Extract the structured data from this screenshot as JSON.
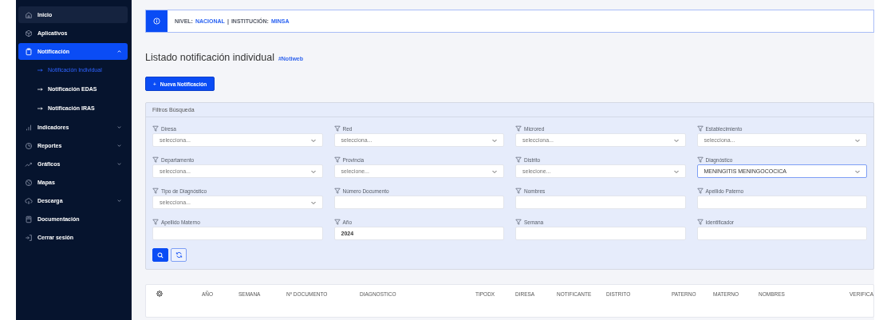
{
  "sidebar": {
    "items": [
      {
        "label": "Inicio",
        "kind": "item",
        "selected": false,
        "highlighted": true
      },
      {
        "label": "Aplicativos",
        "kind": "item",
        "selected": false,
        "highlighted": false
      },
      {
        "label": "Notificación",
        "kind": "item",
        "selected": true,
        "highlighted": false,
        "expanded": true,
        "children": [
          {
            "label": "Notificación Individual",
            "selected": true
          },
          {
            "label": "Notificación EDAS",
            "selected": false
          },
          {
            "label": "Notificación IRAS",
            "selected": false
          }
        ]
      },
      {
        "label": "Indicadores",
        "kind": "item",
        "selected": false,
        "highlighted": false,
        "expanded": false
      },
      {
        "label": "Reportes",
        "kind": "item",
        "selected": false,
        "highlighted": false,
        "expanded": false
      },
      {
        "label": "Gráficos",
        "kind": "item",
        "selected": false,
        "highlighted": false,
        "expanded": false
      },
      {
        "label": "Mapas",
        "kind": "item",
        "selected": false,
        "highlighted": false
      },
      {
        "label": "Descarga",
        "kind": "item",
        "selected": false,
        "highlighted": false,
        "expanded": false
      },
      {
        "label": "Documentación",
        "kind": "item",
        "selected": false,
        "highlighted": false
      },
      {
        "label": "Cerrar sesión",
        "kind": "item",
        "selected": false,
        "highlighted": false
      }
    ]
  },
  "info_bar": {
    "separator": "|",
    "items": [
      {
        "label": "NIVEL:",
        "value": "NACIONAL"
      },
      {
        "label": "INSTITUCIÓN:",
        "value": "MINSA"
      }
    ]
  },
  "page": {
    "title": "Listado notificación individual",
    "tag": "#Notiweb",
    "new_button": "Nueva Notificación",
    "new_button_icon": "+"
  },
  "filters": {
    "title": "Filtros Búsqueda",
    "fields": [
      {
        "label": "Diresa",
        "kind": "select",
        "placeholder": "selecciona...",
        "focused": false
      },
      {
        "label": "Red",
        "kind": "select",
        "placeholder": "selecciona...",
        "focused": false
      },
      {
        "label": "Microred",
        "kind": "select",
        "placeholder": "selecciona...",
        "focused": false
      },
      {
        "label": "Establecimiento",
        "kind": "select",
        "placeholder": "selecciona...",
        "focused": false
      },
      {
        "label": "Departamento",
        "kind": "select",
        "placeholder": "selecciona...",
        "focused": false
      },
      {
        "label": "Provincia",
        "kind": "select",
        "placeholder": "selecione...",
        "focused": false
      },
      {
        "label": "Distrito",
        "kind": "select",
        "placeholder": "selecione...",
        "focused": false
      },
      {
        "label": "Diagnóstico",
        "kind": "select",
        "value": "MENINGITIS MENINGOCOCICA",
        "focused": true
      },
      {
        "label": "Tipo de Diagnóstico",
        "kind": "select",
        "placeholder": "selecciona...",
        "focused": false
      },
      {
        "label": "Número Documento",
        "kind": "text",
        "focused": false
      },
      {
        "label": "Nombres",
        "kind": "text",
        "focused": false
      },
      {
        "label": "Apellido Paterno",
        "kind": "text",
        "focused": false
      },
      {
        "label": "Apellido Materno",
        "kind": "text",
        "focused": false
      },
      {
        "label": "Año",
        "kind": "text",
        "value": "2024",
        "focused": false
      },
      {
        "label": "Semana",
        "kind": "text",
        "focused": false
      },
      {
        "label": "Identificador",
        "kind": "text",
        "focused": false
      }
    ]
  },
  "table": {
    "columns": [
      "AÑO",
      "SEMANA",
      "Nº DOCUMENTO",
      "DIAGNOSTICO",
      "TIPODX",
      "DIRESA",
      "NOTIFICANTE",
      "DISTRITO",
      "PATERNO",
      "MATERNO",
      "NOMBRES",
      "VERIFICA"
    ]
  }
}
